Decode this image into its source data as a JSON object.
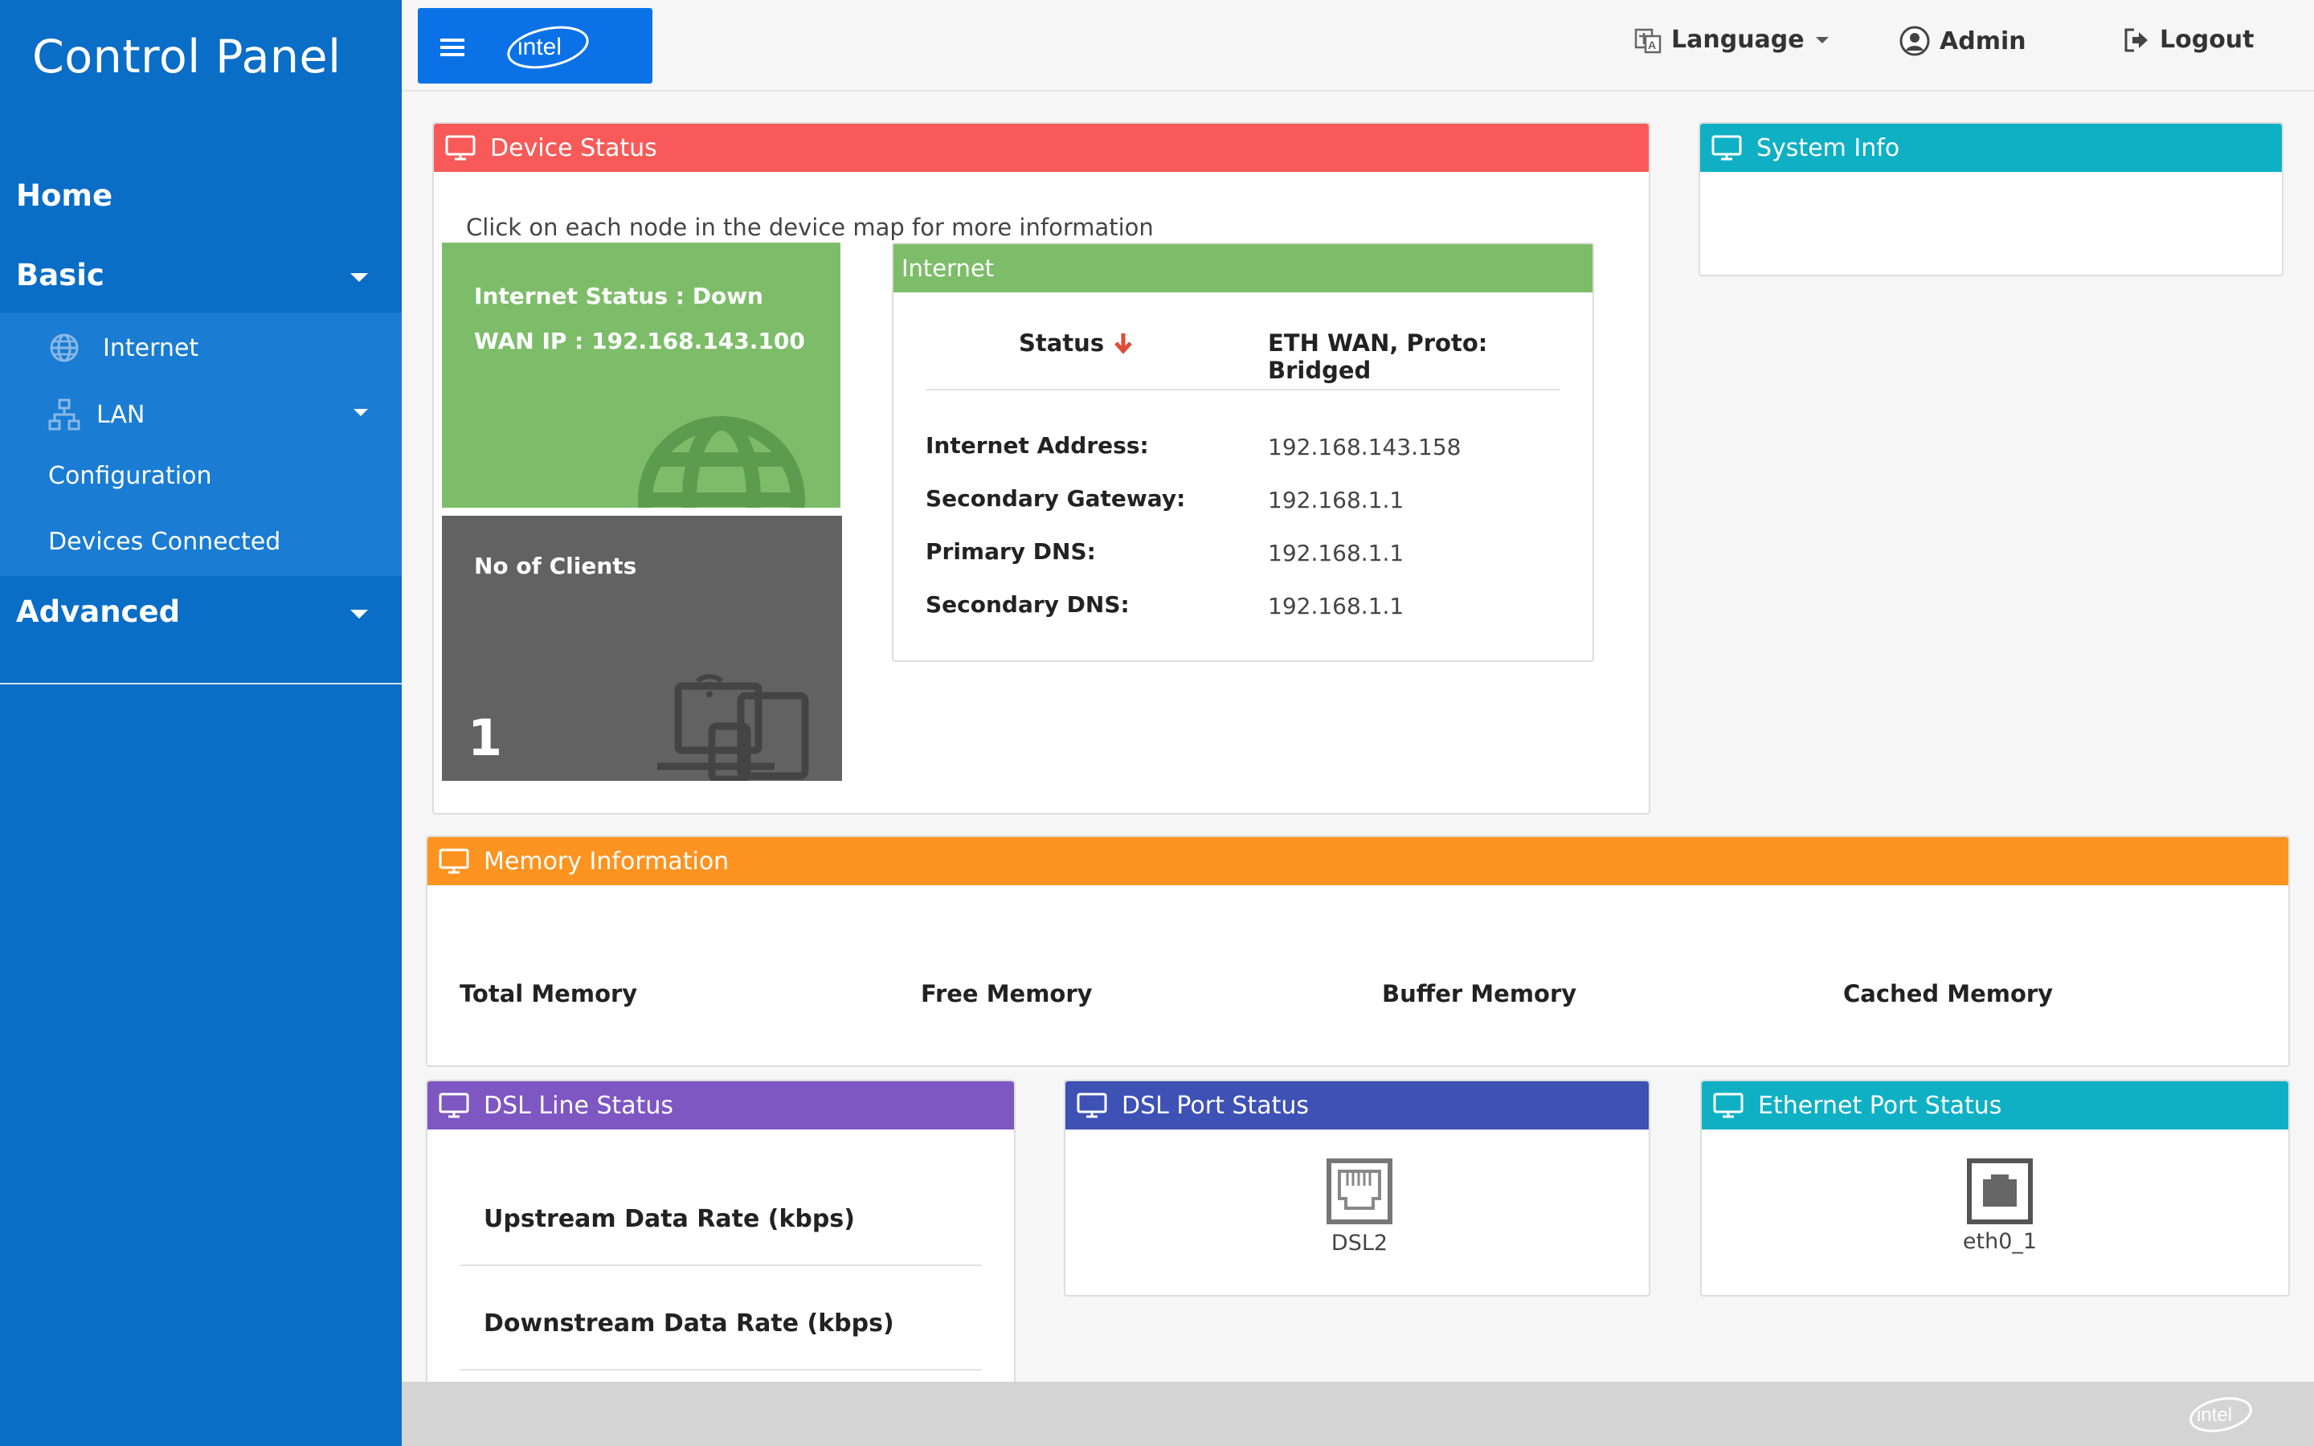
{
  "sidebar": {
    "brand": "Control Panel",
    "home": "Home",
    "basic": "Basic",
    "internet": "Internet",
    "lan": "LAN",
    "configuration": "Configuration",
    "devices_connected": "Devices Connected",
    "advanced": "Advanced"
  },
  "topbar": {
    "logo_text": "intel",
    "language": "Language",
    "admin": "Admin",
    "logout": "Logout"
  },
  "device_status": {
    "title": "Device Status",
    "hint": "Click on each node in the device map for more information",
    "internet_status": "Internet Status : Down",
    "wan_ip": "WAN IP : 192.168.143.100",
    "clients_label": "No of Clients",
    "clients_count": "1"
  },
  "internet_panel": {
    "title": "Internet",
    "status_label": "Status",
    "status_value": "ETH WAN, Proto: Bridged",
    "rows": [
      {
        "label": "Internet Address:",
        "value": "192.168.143.158"
      },
      {
        "label": "Secondary Gateway:",
        "value": "192.168.1.1"
      },
      {
        "label": "Primary DNS:",
        "value": "192.168.1.1"
      },
      {
        "label": "Secondary DNS:",
        "value": "192.168.1.1"
      }
    ]
  },
  "system_info": {
    "title": "System Info"
  },
  "memory": {
    "title": "Memory Information",
    "labels": [
      "Total Memory",
      "Free Memory",
      "Buffer Memory",
      "Cached Memory"
    ]
  },
  "dsl_line": {
    "title": "DSL Line Status",
    "upstream": "Upstream Data Rate (kbps)",
    "downstream": "Downstream Data Rate (kbps)"
  },
  "dsl_port": {
    "title": "DSL Port Status",
    "port": "DSL2"
  },
  "eth_port": {
    "title": "Ethernet Port Status",
    "port": "eth0_1"
  },
  "footer": {
    "logo_text": "intel"
  },
  "colors": {
    "sidebar": "#0a6dc6",
    "device_status_head": "#f75a58",
    "system_info_head": "#0fb0c4",
    "memory_head": "#fd9320",
    "dsl_line_head": "#7e57c2",
    "dsl_port_head": "#3e51b5",
    "eth_port_head": "#0fb0c4",
    "green_tile": "#7dbd69",
    "grey_tile": "#626262",
    "status_down": "#e34a36"
  },
  "icons": [
    "hamburger-icon",
    "language-icon",
    "user-icon",
    "logout-icon",
    "monitor-icon",
    "globe-icon",
    "network-icon",
    "devices-icon",
    "rj11-port-icon",
    "rj45-port-icon",
    "arrow-down-icon"
  ]
}
